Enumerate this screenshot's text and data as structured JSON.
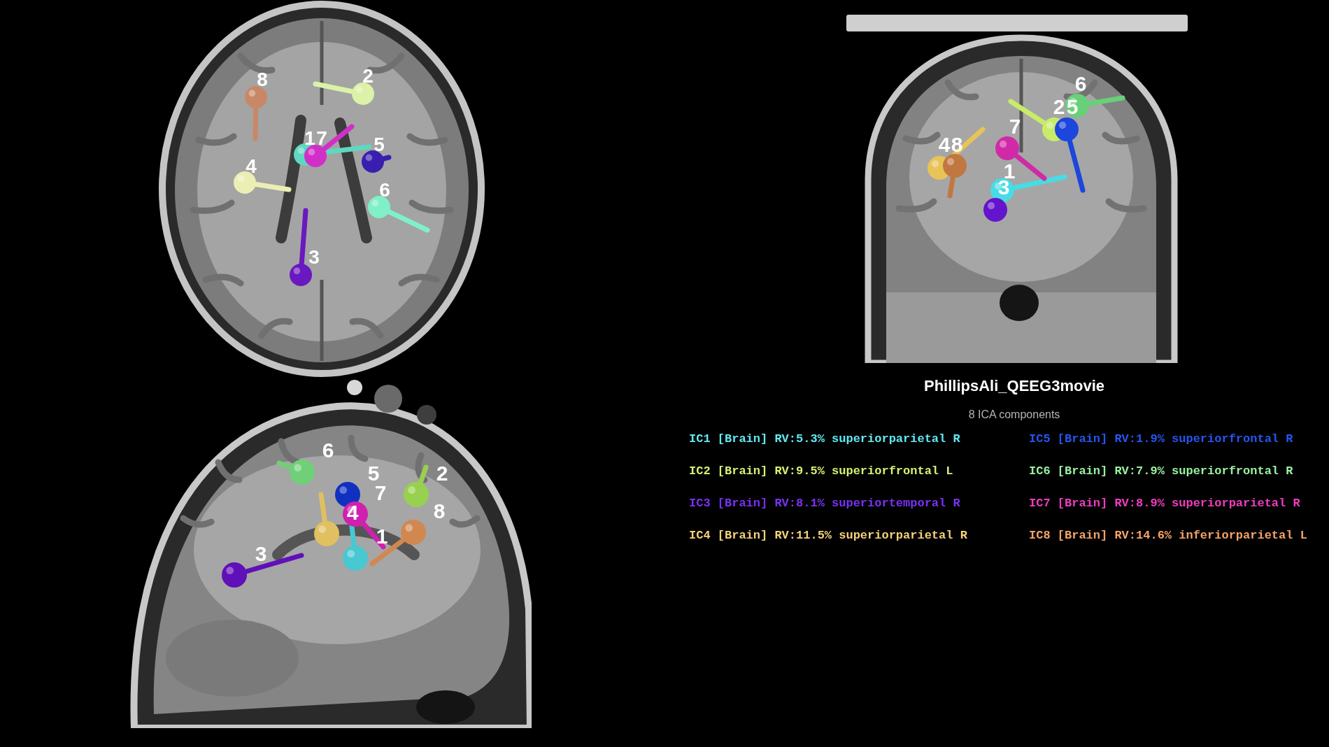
{
  "views": [
    {
      "kind": "axial",
      "dipoles": [
        {
          "label": "1",
          "color": "#5ed8c0"
        },
        {
          "label": "2",
          "color": "#dcf2a8"
        },
        {
          "label": "3",
          "color": "#6a18c0"
        },
        {
          "label": "4",
          "color": "#ecefb4"
        },
        {
          "label": "5",
          "color": "#3a1eb0"
        },
        {
          "label": "6",
          "color": "#80f0c8"
        },
        {
          "label": "7",
          "color": "#d030c8"
        },
        {
          "label": "8",
          "color": "#c88868"
        }
      ]
    },
    {
      "kind": "coronal",
      "dipoles": [
        {
          "label": "1",
          "color": "#48dce4"
        },
        {
          "label": "2",
          "color": "#c8ec68"
        },
        {
          "label": "3",
          "color": "#6414cc"
        },
        {
          "label": "4",
          "color": "#e8c458"
        },
        {
          "label": "5",
          "color": "#1c46dc"
        },
        {
          "label": "6",
          "color": "#68d078"
        },
        {
          "label": "7",
          "color": "#d02aa8"
        },
        {
          "label": "8",
          "color": "#c07840"
        }
      ]
    },
    {
      "kind": "sagittal",
      "dipoles": [
        {
          "label": "1",
          "color": "#48c8d0"
        },
        {
          "label": "2",
          "color": "#98d050"
        },
        {
          "label": "3",
          "color": "#6010b8"
        },
        {
          "label": "4",
          "color": "#e0c060"
        },
        {
          "label": "5",
          "color": "#1030c0"
        },
        {
          "label": "6",
          "color": "#70d078"
        },
        {
          "label": "7",
          "color": "#d020b0"
        },
        {
          "label": "8",
          "color": "#d08850"
        }
      ]
    }
  ],
  "legend": {
    "title": "PhillipsAli_QEEG3movie",
    "subtitle": "8 ICA components",
    "components": [
      {
        "text": "IC1 [Brain] RV:5.3% superiorparietal R",
        "color": "#60e8f0"
      },
      {
        "text": "IC2 [Brain] RV:9.5% superiorfrontal L",
        "color": "#d4f270"
      },
      {
        "text": "IC3 [Brain] RV:8.1% superiortemporal R",
        "color": "#7b30f5"
      },
      {
        "text": "IC4 [Brain] RV:11.5% superiorparietal R",
        "color": "#f5d27a"
      },
      {
        "text": "IC5 [Brain] RV:1.9% superiorfrontal R",
        "color": "#2656f0"
      },
      {
        "text": "IC6 [Brain] RV:7.9% superiorfrontal R",
        "color": "#98f0a0"
      },
      {
        "text": "IC7 [Brain] RV:8.9% superiorparietal R",
        "color": "#f03cc0"
      },
      {
        "text": "IC8 [Brain] RV:14.6% inferiorparietal L",
        "color": "#f5a468"
      }
    ]
  }
}
